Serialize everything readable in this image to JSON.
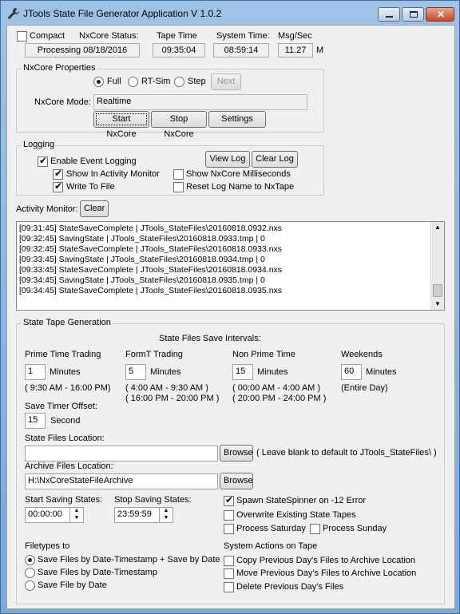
{
  "window": {
    "title": "JTools State File Generator Application V 1.0.2"
  },
  "top": {
    "compact_label": "Compact",
    "nxcore_status_label": "NxCore Status:",
    "nxcore_status_value": "Processing 08/18/2016",
    "tape_time_label": "Tape Time",
    "tape_time_value": "09:35:04",
    "system_time_label": "System Time:",
    "system_time_value": "08:59:14",
    "msg_label": "Msg/Sec",
    "msg_value": "11.27",
    "msg_unit": "M"
  },
  "nxcore": {
    "group_label": "NxCore Properties",
    "mode_full": "Full",
    "mode_rtsim": "RT-Sim",
    "mode_step": "Step",
    "next_button": "Next",
    "mode_label": "NxCore Mode:",
    "mode_value": "Realtime",
    "start_button": "Start NxCore",
    "stop_button": "Stop NxCore",
    "settings_button": "Settings"
  },
  "logging": {
    "group_label": "Logging",
    "enable_event_logging": "Enable Event Logging",
    "view_log_button": "View Log",
    "clear_log_button": "Clear Log",
    "show_in_activity": "Show In Activity Monitor",
    "show_ms": "Show NxCore Milliseconds",
    "write_to_file": "Write To File",
    "reset_log_name": "Reset Log Name to NxTape"
  },
  "activity": {
    "label": "Activity Monitor:",
    "clear_button": "Clear",
    "lines": [
      "[09:31:45] StateSaveComplete | JTools_StateFiles\\20160818.0932.nxs",
      "[09:32:45] SavingState | JTools_StateFiles\\20160818.0933.tmp | 0",
      "[09:32:45] StateSaveComplete | JTools_StateFiles\\20160818.0933.nxs",
      "[09:33:45] SavingState | JTools_StateFiles\\20160818.0934.tmp | 0",
      "[09:33:45] StateSaveComplete | JTools_StateFiles\\20160818.0934.nxs",
      "[09:34:45] SavingState | JTools_StateFiles\\20160818.0935.tmp | 0",
      "[09:34:45] StateSaveComplete | JTools_StateFiles\\20160818.0935.nxs"
    ]
  },
  "tape": {
    "group_label": "State Tape Generation",
    "intervals_title": "State Files Save Intervals:",
    "prime_label": "Prime Time Trading",
    "prime_value": "1",
    "prime_unit": "Minutes",
    "prime_range": "( 9:30 AM - 16:00 PM)",
    "formt_label": "FormT Trading",
    "formt_value": "5",
    "formt_unit": "Minutes",
    "formt_range1": "( 4:00 AM - 9:30 AM )",
    "formt_range2": "( 16:00 PM - 20:00 PM )",
    "nonprime_label": "Non Prime Time",
    "nonprime_value": "15",
    "nonprime_unit": "Minutes",
    "nonprime_range1": "( 00:00 AM - 4:00 AM )",
    "nonprime_range2": "( 20:00 PM - 24:00 PM )",
    "weekends_label": "Weekends",
    "weekends_value": "60",
    "weekends_unit": "Minutes",
    "weekends_range": "(Entire Day)",
    "timer_offset_label": "Save Timer Offset:",
    "timer_offset_value": "15",
    "timer_offset_unit": "Seconds",
    "state_location_label": "State Files Location:",
    "state_location_value": "",
    "browse_button": "Browse",
    "state_location_hint": "( Leave blank to default to JTools_StateFiles\\ )",
    "archive_location_label": "Archive Files Location:",
    "archive_location_value": "H:\\NxCoreStateFileArchive",
    "archive_browse_button": "Browse",
    "start_saving_label": "Start Saving States:",
    "start_saving_value": "00:00:00",
    "stop_saving_label": "Stop Saving States:",
    "stop_saving_value": "23:59:59",
    "spawn_spinner": "Spawn StateSpinner on -12 Error",
    "overwrite_tapes": "Overwrite Existing State Tapes",
    "process_saturday": "Process Saturday",
    "process_sunday": "Process Sunday",
    "filetypes_label": "Filetypes to",
    "ft_opt1": "Save Files by Date-Timestamp + Save by Date",
    "ft_opt2": "Save Files by Date-Timestamp",
    "ft_opt3": "Save File by Date",
    "system_actions_label": "System Actions on Tape",
    "copy_prev": "Copy Previous Day's Files to Archive Location",
    "move_prev": "Move Previous Day's Files to Archive Location",
    "delete_prev": "Delete Previous Day's Files"
  }
}
